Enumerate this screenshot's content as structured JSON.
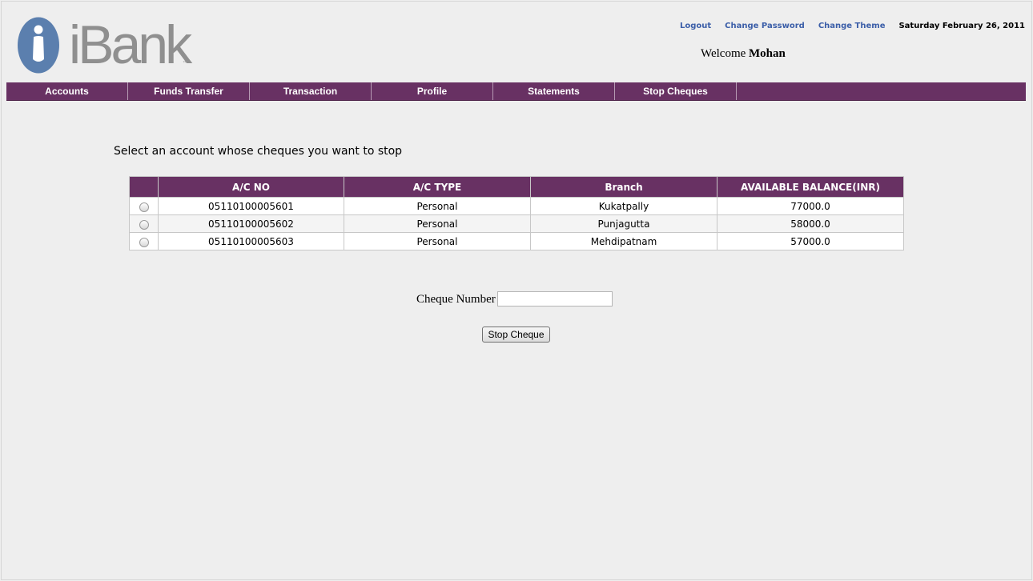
{
  "brand": {
    "logo_text": "iBank",
    "logo_color": "#8f8f8f",
    "mark_color": "#5b7fae"
  },
  "header": {
    "links": [
      "Logout",
      "Change Password",
      "Change Theme"
    ],
    "date": "Saturday February 26, 2011",
    "welcome_prefix": "Welcome",
    "user_name": "Mohan"
  },
  "nav": {
    "items": [
      "Accounts",
      "Funds Transfer",
      "Transaction",
      "Profile",
      "Statements",
      "Stop Cheques"
    ],
    "color": "#683163"
  },
  "main": {
    "instruction": "Select an account whose cheques you want to stop",
    "table": {
      "headers": [
        "A/C NO",
        "A/C TYPE",
        "Branch",
        "AVAILABLE BALANCE(INR)"
      ],
      "rows": [
        {
          "ac_no": "05110100005601",
          "type": "Personal",
          "branch": "Kukatpally",
          "balance": "77000.0"
        },
        {
          "ac_no": "05110100005602",
          "type": "Personal",
          "branch": "Punjagutta",
          "balance": "58000.0"
        },
        {
          "ac_no": "05110100005603",
          "type": "Personal",
          "branch": "Mehdipatnam",
          "balance": "57000.0"
        }
      ]
    },
    "cheque_label": "Cheque Number",
    "cheque_value": "",
    "submit_label": "Stop Cheque"
  }
}
